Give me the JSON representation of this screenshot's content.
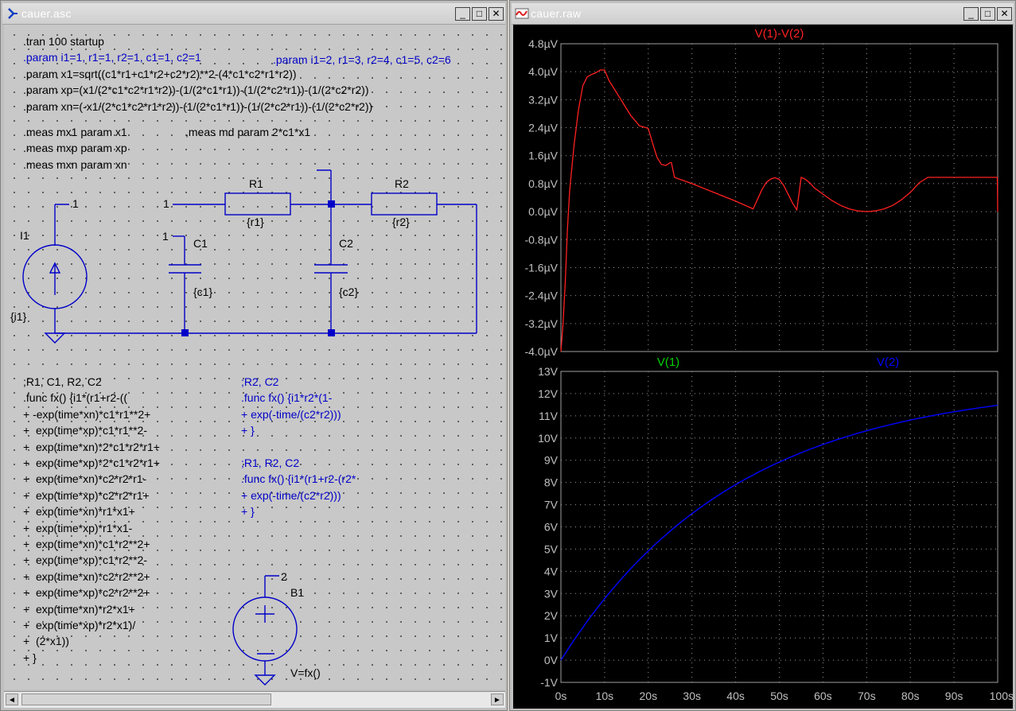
{
  "left_window": {
    "title": "cauer.asc",
    "buttons": {
      "minimize": "_",
      "maximize": "□",
      "close": "✕"
    },
    "directives_top": [
      {
        "text": ".tran 100 startup",
        "color": "#000000"
      },
      {
        "text": ".param i1=1, r1=1, r2=1, c1=1, c2=1",
        "color": "#0000c8"
      },
      {
        "text": ".param x1=sqrt((c1*r1+c1*r2+c2*r2)**2-(4*c1*c2*r1*r2))",
        "color": "#000000"
      },
      {
        "text": ".param xp=(x1/(2*c1*c2*r1*r2))-(1/(2*c1*r1))-(1/(2*c2*r1))-(1/(2*c2*r2))",
        "color": "#000000"
      },
      {
        "text": ".param xn=(-x1/(2*c1*c2*r1*r2))-(1/(2*c1*r1))-(1/(2*c2*r1))-(1/(2*c2*r2))",
        "color": "#000000"
      }
    ],
    "param_alt": ".param i1=2, r1=3, r2=4, c1=5, c2=6",
    "meas": [
      ".meas mx1 param x1",
      ".meas mxp param xp",
      ".meas mxn param xn"
    ],
    "meas_md": ",meas md param 2*c1*x1",
    "schematic": {
      "r1_name": "R1",
      "r1_value": "{r1}",
      "r2_name": "R2",
      "r2_value": "{r2}",
      "c1_name": "C1",
      "c1_value": "{c1}",
      "c2_name": "C2",
      "c2_value": "{c2}",
      "i1_name": "I1",
      "i1_value": "{i1}",
      "net1_a": "1",
      "net1_b": "1",
      "net1_c": "1",
      "b1_name": "B1",
      "b1_net": "2",
      "b1_value": "V=fx()"
    },
    "func_left": [
      ";R1, C1, R2, C2",
      ".func fx() {i1*(r1+r2-((",
      "+ -exp(time*xn)*c1*r1**2+",
      "+  exp(time*xp)*c1*r1**2-",
      "+  exp(time*xn)*2*c1*r2*r1+",
      "+  exp(time*xp)*2*c1*r2*r1+",
      "+  exp(time*xn)*c2*r2*r1-",
      "+  exp(time*xp)*c2*r2*r1+",
      "+  exp(time*xn)*r1*x1+",
      "+  exp(time*xp)*r1*x1-",
      "+  exp(time*xn)*c1*r2**2+",
      "+  exp(time*xp)*c1*r2**2-",
      "+  exp(time*xn)*c2*r2**2+",
      "+  exp(time*xp)*c2*r2**2+",
      "+  exp(time*xn)*r2*x1+",
      "+  exp(time*xp)*r2*x1)/",
      "+  (2*x1))",
      "+ }"
    ],
    "func_right_1": [
      ";R2, C2",
      ".func fx() {i1*r2*(1-",
      "+ exp(-time/(c2*r2)))",
      "+ }"
    ],
    "func_right_2": [
      ";R1, R2, C2",
      ".func fx() {i1*(r1+r2-(r2*",
      "+ exp(-time/(c2*r2)))",
      "+ }"
    ],
    "scroll_left": "◄",
    "scroll_right": "►"
  },
  "right_window": {
    "title": "cauer.raw",
    "buttons": {
      "minimize": "_",
      "maximize": "□",
      "close": "✕"
    }
  },
  "colors": {
    "wire": "#0000c8",
    "schematic_bg": "#c8c8c8",
    "plot_bg": "#000000",
    "red_trace": "#ff2020",
    "green_label": "#00d000",
    "blue_trace": "#0000ff"
  },
  "chart_data": [
    {
      "type": "line",
      "title": "V(1)-V(2)",
      "series": [
        {
          "name": "V(1)-V(2)",
          "color": "#ff2020",
          "x": [
            0,
            0.5,
            1,
            1.5,
            2,
            3,
            4,
            5,
            6,
            7,
            8,
            9,
            10,
            11,
            12,
            13,
            14,
            15,
            16,
            17,
            18,
            19,
            20,
            21,
            22,
            23,
            24,
            25,
            25.3,
            26,
            30,
            35,
            40,
            44,
            45,
            46,
            47,
            48,
            49,
            50,
            51,
            52,
            53,
            54,
            54.5,
            55,
            56,
            57,
            58,
            60,
            62,
            64,
            66,
            68,
            70,
            72,
            74,
            76,
            78,
            80,
            82,
            84,
            86,
            88,
            90,
            92,
            94,
            96,
            98,
            99.9,
            100
          ],
          "y": [
            -4.0,
            -3.2,
            -2.0,
            -0.5,
            0.6,
            1.9,
            2.9,
            3.6,
            3.85,
            3.92,
            3.97,
            4.05,
            4.05,
            3.75,
            3.55,
            3.35,
            3.15,
            2.95,
            2.75,
            2.6,
            2.45,
            2.42,
            2.38,
            1.95,
            1.55,
            1.35,
            1.32,
            1.4,
            1.4,
            0.98,
            0.8,
            0.55,
            0.3,
            0.08,
            0.35,
            0.62,
            0.83,
            0.93,
            0.97,
            0.92,
            0.75,
            0.5,
            0.25,
            0.05,
            0.5,
            0.98,
            0.92,
            0.82,
            0.68,
            0.5,
            0.32,
            0.18,
            0.08,
            0.02,
            0.0,
            0.02,
            0.08,
            0.18,
            0.34,
            0.55,
            0.82,
            0.98,
            0.98,
            0.98,
            0.98,
            0.98,
            0.98,
            0.98,
            0.98,
            0.98,
            0.0
          ]
        }
      ],
      "x_range": [
        0,
        100
      ],
      "ylim": [
        -4.0,
        4.8
      ],
      "y_ticks": [
        "4.8µV",
        "4.0µV",
        "3.2µV",
        "2.4µV",
        "1.6µV",
        "0.8µV",
        "0.0µV",
        "-0.8µV",
        "-1.6µV",
        "-2.4µV",
        "-3.2µV",
        "-4.0µV"
      ],
      "grid": true
    },
    {
      "type": "line",
      "legend": [
        {
          "name": "V(1)",
          "color": "#00d000"
        },
        {
          "name": "V(2)",
          "color": "#0000ff"
        }
      ],
      "series": [
        {
          "name": "V(2)",
          "color": "#0000ff",
          "formula": "12.5*(1-exp(-t/40))"
        }
      ],
      "x_range": [
        0,
        100
      ],
      "ylim": [
        -1,
        13
      ],
      "y_ticks": [
        "13V",
        "12V",
        "11V",
        "10V",
        "9V",
        "8V",
        "7V",
        "6V",
        "5V",
        "4V",
        "3V",
        "2V",
        "1V",
        "0V",
        "-1V"
      ],
      "x_ticks": [
        "0s",
        "10s",
        "20s",
        "30s",
        "40s",
        "50s",
        "60s",
        "70s",
        "80s",
        "90s",
        "100s"
      ],
      "grid": true
    }
  ]
}
